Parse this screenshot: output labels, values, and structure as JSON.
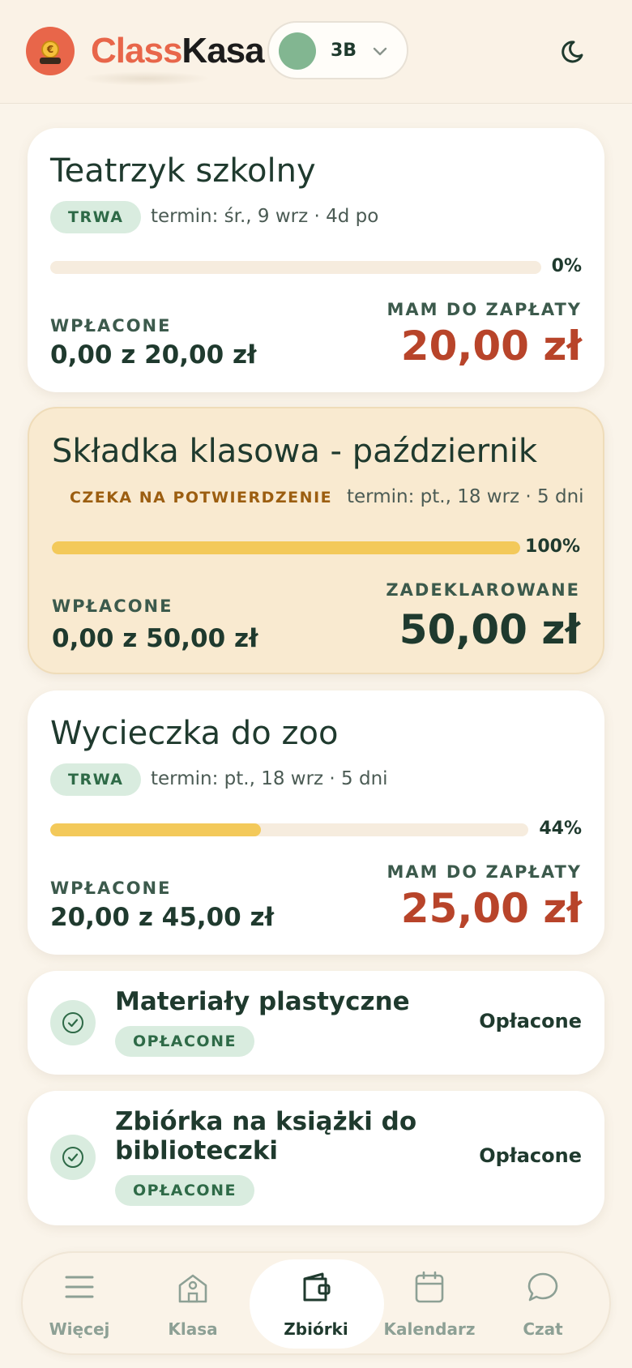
{
  "header": {
    "brand_part1": "Class",
    "brand_part2": "Kasa",
    "logo_symbol": "€",
    "class_name": "3B",
    "class_color": "#82b691",
    "theme_icon": "moon-icon"
  },
  "collections": [
    {
      "title": "Teatrzyk szkolny",
      "status": "TRWA",
      "deadline": "termin: śr., 9 wrz · 4d po",
      "progress_percent": 0,
      "progress_label": "0%",
      "paid_label": "WPŁACONE",
      "paid_value": "0,00 z 20,00 zł",
      "due_label": "MAM DO ZAPŁATY",
      "due_value": "20,00 zł"
    },
    {
      "title": "Składka klasowa - październik",
      "status": "CZEKA NA POTWIERDZENIE",
      "deadline": "termin: pt., 18 wrz · 5 dni",
      "progress_percent": 100,
      "progress_label": "100%",
      "paid_label": "WPŁACONE",
      "paid_value": "0,00 z 50,00 zł",
      "due_label": "ZADEKLAROWANE",
      "due_value": "50,00 zł"
    },
    {
      "title": "Wycieczka do zoo",
      "status": "TRWA",
      "deadline": "termin: pt., 18 wrz · 5 dni",
      "progress_percent": 44,
      "progress_label": "44%",
      "paid_label": "WPŁACONE",
      "paid_value": "20,00 z 45,00 zł",
      "due_label": "MAM DO ZAPŁATY",
      "due_value": "25,00 zł"
    }
  ],
  "paid_collections": [
    {
      "title": "Materiały plastyczne",
      "badge": "OPŁACONE",
      "status": "Opłacone"
    },
    {
      "title": "Zbiórka na książki do biblioteczki",
      "badge": "OPŁACONE",
      "status": "Opłacone"
    }
  ],
  "colors": {
    "accent": "#e8664a",
    "due_red": "#b8442a",
    "progress": "#f3c95a",
    "badge_green": "#d9ecdf"
  },
  "nav": [
    {
      "label": "Więcej",
      "icon": "menu-icon"
    },
    {
      "label": "Klasa",
      "icon": "school-icon"
    },
    {
      "label": "Zbiórki",
      "icon": "wallet-icon",
      "active": true
    },
    {
      "label": "Kalendarz",
      "icon": "calendar-icon"
    },
    {
      "label": "Czat",
      "icon": "chat-icon"
    }
  ]
}
